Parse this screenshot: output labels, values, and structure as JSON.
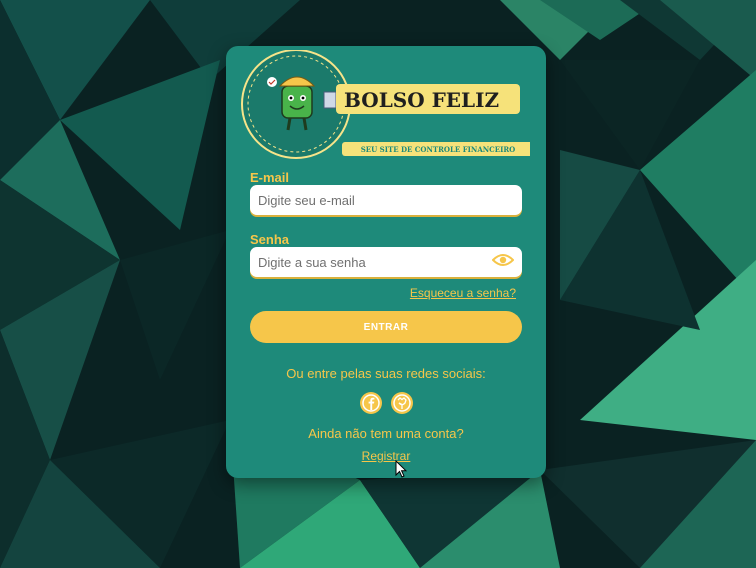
{
  "brand": {
    "name": "BOLSO FELIZ",
    "tagline": "SEU SITE DE CONTROLE FINANCEIRO"
  },
  "form": {
    "email_label": "E-mail",
    "email_placeholder": "Digite seu e-mail",
    "password_label": "Senha",
    "password_placeholder": "Digite a sua senha",
    "forgot_link": "Esqueceu a senha?",
    "submit_label": "ENTRAR"
  },
  "social": {
    "prompt": "Ou entre pelas suas redes sociais:",
    "providers": [
      "facebook-icon",
      "github-icon"
    ]
  },
  "signup": {
    "prompt": "Ainda não tem uma conta?",
    "link": "Registrar"
  },
  "colors": {
    "card": "#1e8a7a",
    "accent": "#f6c64a",
    "background": "#0b2a2a"
  }
}
